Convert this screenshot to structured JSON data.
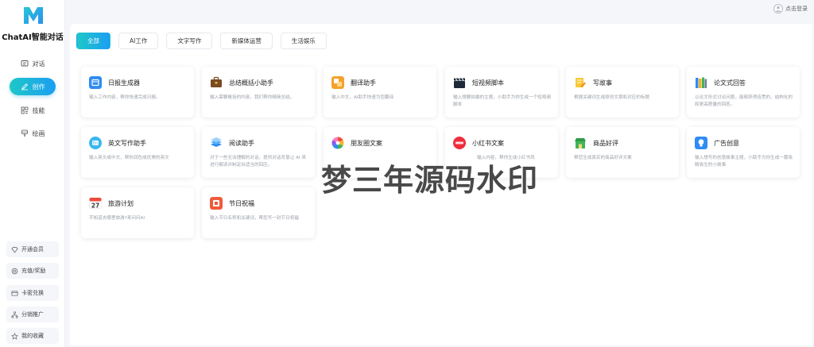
{
  "brand": {
    "name": "ChatAI智能对话",
    "colors": {
      "accent_start": "#1ec8c8",
      "accent_end": "#1c9ef2"
    }
  },
  "sidebar": {
    "items": [
      {
        "label": "对话",
        "icon": "chat-icon",
        "active": false
      },
      {
        "label": "创作",
        "icon": "edit-icon",
        "active": true
      },
      {
        "label": "技能",
        "icon": "skills-icon",
        "active": false
      },
      {
        "label": "绘画",
        "icon": "paint-icon",
        "active": false
      }
    ],
    "bottom": [
      {
        "label": "开通会员",
        "icon": "diamond-icon"
      },
      {
        "label": "充值/奖励",
        "icon": "coin-icon"
      },
      {
        "label": "卡密兑换",
        "icon": "card-icon"
      },
      {
        "label": "分销推广",
        "icon": "share-icon"
      },
      {
        "label": "我的收藏",
        "icon": "star-icon"
      }
    ]
  },
  "header": {
    "login_label": "点击登录"
  },
  "tabs": [
    {
      "label": "全部",
      "active": true
    },
    {
      "label": "AI工作",
      "active": false
    },
    {
      "label": "文字写作",
      "active": false
    },
    {
      "label": "新媒体运营",
      "active": false
    },
    {
      "label": "生活娱乐",
      "active": false
    }
  ],
  "cards": [
    {
      "title": "日报生成器",
      "desc": "输入工作内容，帮你快速完成日报。",
      "icon": "calendar-icon"
    },
    {
      "title": "总结概括小助手",
      "desc": "输入需要概括的内容，我们帮你精简总结。",
      "icon": "briefcase-icon"
    },
    {
      "title": "翻译助手",
      "desc": "输入中文，AI助手快速为您翻译",
      "icon": "translate-icon"
    },
    {
      "title": "短视频脚本",
      "desc": "输入想要拍摄的主题，小助手为你生成一个短视频脚本",
      "icon": "clapper-icon"
    },
    {
      "title": "写故事",
      "desc": "根据关键词生成原创文章和对应的标题",
      "icon": "pencil-note-icon"
    },
    {
      "title": "论文式回答",
      "desc": "以论文形式讨论问题，能够获得连贯的、结构化的和更高质量的回答。",
      "icon": "books-icon"
    },
    {
      "title": "英文写作助手",
      "desc": "输入英文或中文，帮你润色成优美的英文",
      "icon": "english-icon"
    },
    {
      "title": "阅读助手",
      "desc": "对于一些无法理解的对话，提供对话背景让 AI 来进行解读并制定出适当的回应。",
      "icon": "book-stack-icon"
    },
    {
      "title": "朋友圈文案",
      "desc": "",
      "icon": "camera-aperture-icon"
    },
    {
      "title": "小红书文案",
      "desc": "输入内容，帮你生成小红书风",
      "icon": "xiaohongshu-icon"
    },
    {
      "title": "商品好评",
      "desc": "帮您生成真实的商品好评文案",
      "icon": "shop-icon"
    },
    {
      "title": "广告创意",
      "desc": "输入想写的创意故事主题，小助手为你生成一篇吸睛吸生的小故事",
      "icon": "lightbulb-icon"
    },
    {
      "title": "旅游计划",
      "desc": "不知道去哪里旅游?来问问AI",
      "icon": "date-27-icon",
      "date_text": "27"
    },
    {
      "title": "节日祝福",
      "desc": "输入节日名称和关键词，帮您写一封节日祝福",
      "icon": "greeting-icon"
    }
  ],
  "watermark": "梦三年源码水印"
}
